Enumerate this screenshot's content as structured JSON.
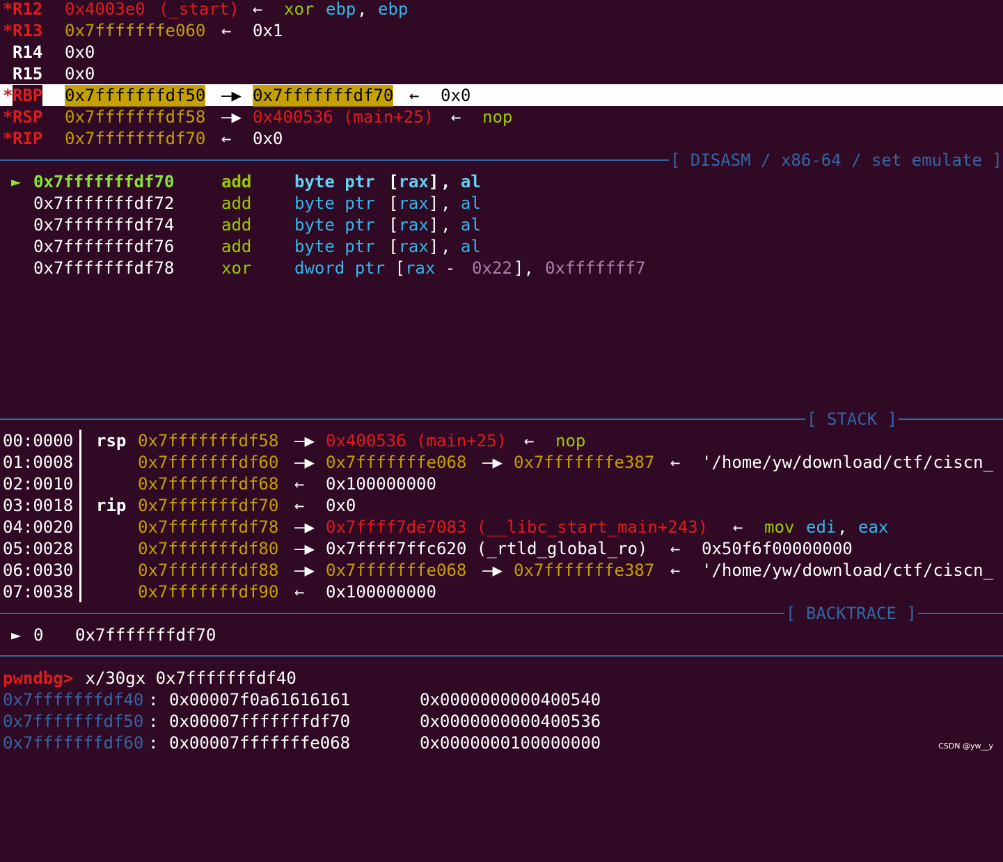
{
  "registers": [
    {
      "star": "*",
      "name": "R12",
      "value": "0x4003e0",
      "sym": "(_start)",
      "arrow": "←",
      "tail1": "xor",
      "tail2": "ebp",
      "tail3": ", ",
      "tail4": "ebp"
    },
    {
      "star": "*",
      "name": "R13",
      "value": "0x7fffffffe060",
      "arrow": "←",
      "tail": "0x1"
    },
    {
      "name": "R14",
      "value": "0x0"
    },
    {
      "name": "R15",
      "value": "0x0"
    },
    {
      "star": "*",
      "name": "RBP",
      "value": "0x7fffffffdf50",
      "arrow1": "—▶",
      "target": "0x7fffffffdf70",
      "arrow2": "←",
      "tail": "0x0"
    },
    {
      "star": "*",
      "name": "RSP",
      "value": "0x7fffffffdf58",
      "arrow1": "—▶",
      "target": "0x400536 (main+25)",
      "arrow2": "←",
      "tail": "nop"
    },
    {
      "star": "*",
      "name": "RIP",
      "value": "0x7fffffffdf70",
      "arrow": "←",
      "tail": "0x0"
    }
  ],
  "disasm_header": "[ DISASM / x86-64 / set emulate ]",
  "disasm": [
    {
      "marker": "►",
      "addr": "0x7fffffffdf70",
      "mn": "add",
      "op1": "byte ptr",
      "op2": "[rax]",
      "op3": ", al"
    },
    {
      "marker": "",
      "addr": "0x7fffffffdf72",
      "mn": "add",
      "op1": "byte ptr",
      "op2": "[rax]",
      "op3": ", al"
    },
    {
      "marker": "",
      "addr": "0x7fffffffdf74",
      "mn": "add",
      "op1": "byte ptr",
      "op2": "[rax]",
      "op3": ", al"
    },
    {
      "marker": "",
      "addr": "0x7fffffffdf76",
      "mn": "add",
      "op1": "byte ptr",
      "op2": "[rax]",
      "op3": ", al"
    },
    {
      "marker": "",
      "addr": "0x7fffffffdf78",
      "mn": "xor",
      "op1": "dword ptr [rax - ",
      "imm1": "0x22",
      "op2": "], ",
      "imm2": "0xfffffff7"
    }
  ],
  "stack_header": "[ STACK ]",
  "stack": [
    {
      "idx": "00:0000",
      "reg": "rsp",
      "addr": "0x7fffffffdf58",
      "a1": "—▶",
      "v1": "0x400536 (main+25)",
      "a2": "←",
      "v2": "nop"
    },
    {
      "idx": "01:0008",
      "reg": "",
      "addr": "0x7fffffffdf60",
      "a1": "—▶",
      "v1": "0x7fffffffe068",
      "a2": "—▶",
      "v2": "0x7fffffffe387",
      "a3": "←",
      "v3": "'/home/yw/download/ctf/ciscn_"
    },
    {
      "idx": "02:0010",
      "reg": "",
      "addr": "0x7fffffffdf68",
      "a1": "←",
      "v1": "0x100000000"
    },
    {
      "idx": "03:0018",
      "reg": "rip",
      "addr": "0x7fffffffdf70",
      "a1": "←",
      "v1": "0x0"
    },
    {
      "idx": "04:0020",
      "reg": "",
      "addr": "0x7fffffffdf78",
      "a1": "—▶",
      "v1": "0x7ffff7de7083 (__libc_start_main+243)",
      "a2": "←",
      "v2a": "mov",
      "v2b": "edi",
      "v2c": ", ",
      "v2d": "eax"
    },
    {
      "idx": "05:0028",
      "reg": "",
      "addr": "0x7fffffffdf80",
      "a1": "—▶",
      "v1": "0x7ffff7ffc620 (_rtld_global_ro)",
      "a2": "←",
      "v2": "0x50f6f00000000"
    },
    {
      "idx": "06:0030",
      "reg": "",
      "addr": "0x7fffffffdf88",
      "a1": "—▶",
      "v1": "0x7fffffffe068",
      "a2": "—▶",
      "v2": "0x7fffffffe387",
      "a3": "←",
      "v3": "'/home/yw/download/ctf/ciscn_"
    },
    {
      "idx": "07:0038",
      "reg": "",
      "addr": "0x7fffffffdf90",
      "a1": "←",
      "v1": "0x100000000"
    }
  ],
  "backtrace_header": "[ BACKTRACE ]",
  "backtrace": {
    "marker": "►",
    "frame": "0",
    "addr": "0x7fffffffdf70"
  },
  "prompt": {
    "label": "pwndbg>",
    "command": " x/30gx 0x7fffffffdf40"
  },
  "memory": [
    {
      "addr": "0x7fffffffdf40",
      "colon": ":",
      "q1": "0x00007f0a61616161",
      "q2": "0x0000000000400540"
    },
    {
      "addr": "0x7fffffffdf50",
      "colon": ":",
      "q1": "0x00007fffffffdf70",
      "q2": "0x0000000000400536"
    },
    {
      "addr": "0x7fffffffdf60",
      "colon": ":",
      "q1": "0x00007fffffffe068",
      "q2": "0x0000000100000000"
    }
  ],
  "watermark": "CSDN @yw__y",
  "colors": {
    "background": "#300a24",
    "accent_blue": "#3465a4",
    "red": "#e01b1b",
    "yellow": "#c4a000",
    "green": "#9ac900"
  }
}
